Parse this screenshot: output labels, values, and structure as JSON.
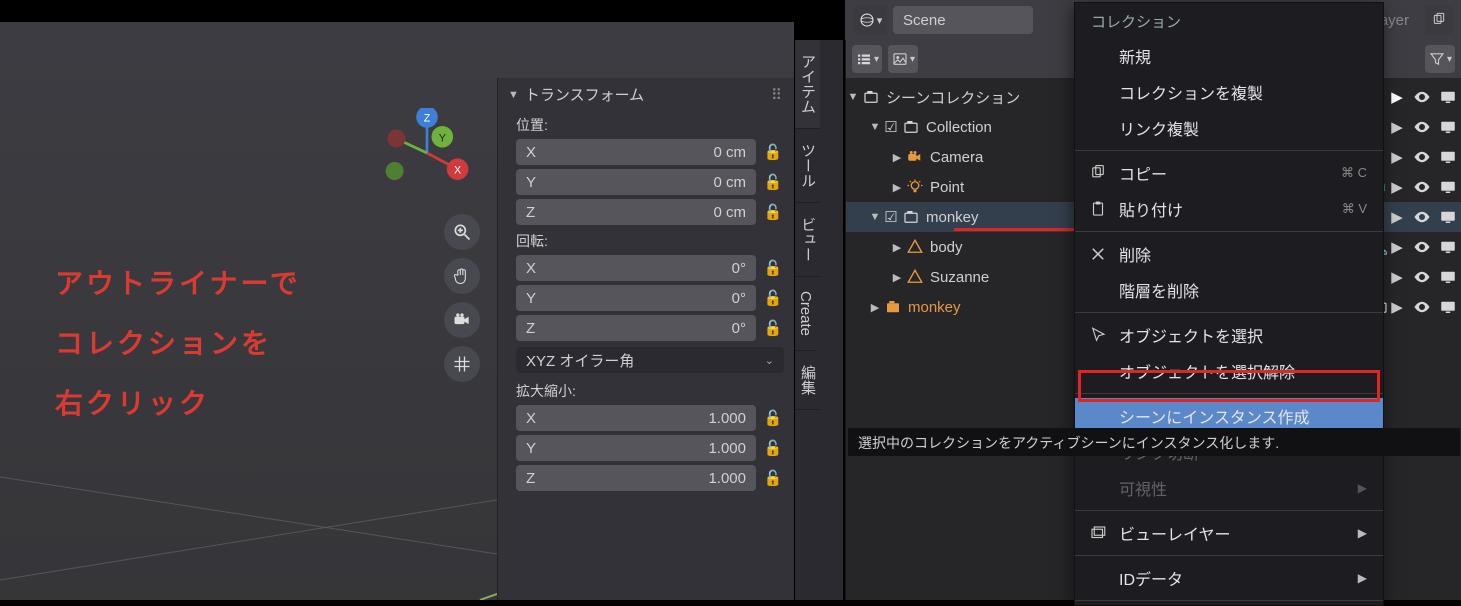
{
  "scene_field": "Scene",
  "view_layer_field": "View Layer",
  "annotation_lines": [
    "アウトライナーで",
    "コレクションを",
    "右クリック"
  ],
  "header": {
    "shading_selected_index": 2
  },
  "npanel": {
    "title": "トランスフォーム",
    "location": {
      "header": "位置:",
      "x_label": "X",
      "y_label": "Y",
      "z_label": "Z",
      "x": "0 cm",
      "y": "0 cm",
      "z": "0 cm"
    },
    "rotation": {
      "header": "回転:",
      "x_label": "X",
      "y_label": "Y",
      "z_label": "Z",
      "x": "0°",
      "y": "0°",
      "z": "0°",
      "mode": "XYZ オイラー角"
    },
    "scale": {
      "header": "拡大縮小:",
      "x_label": "X",
      "y_label": "Y",
      "z_label": "Z",
      "x": "1.000",
      "y": "1.000",
      "z": "1.000"
    }
  },
  "tabs": [
    "アイテム",
    "ツール",
    "ビュー",
    "Create",
    "編集"
  ],
  "outliner": {
    "root": "シーンコレクション",
    "items": [
      {
        "label": "Collection",
        "kind": "collection",
        "children": [
          {
            "label": "Camera",
            "kind": "camera"
          },
          {
            "label": "Point",
            "kind": "light"
          }
        ]
      },
      {
        "label": "monkey",
        "kind": "collection",
        "checked": true,
        "children": [
          {
            "label": "body",
            "kind": "mesh",
            "wrench": true
          },
          {
            "label": "Suzanne",
            "kind": "mesh"
          }
        ]
      },
      {
        "label": "monkey",
        "kind": "instance"
      }
    ]
  },
  "menu": {
    "title": "コレクション",
    "items": [
      {
        "label": "新規"
      },
      {
        "label": "コレクションを複製"
      },
      {
        "label": "リンク複製"
      },
      {
        "sep": true
      },
      {
        "label": "コピー",
        "icon": "copy",
        "kbd": "⌘ C"
      },
      {
        "label": "貼り付け",
        "icon": "paste",
        "kbd": "⌘ V"
      },
      {
        "sep": true
      },
      {
        "label": "削除",
        "icon": "x"
      },
      {
        "label": "階層を削除"
      },
      {
        "sep": true
      },
      {
        "label": "オブジェクトを選択",
        "icon": "cursor"
      },
      {
        "label": "オブジェクトを選択解除"
      },
      {
        "sep": true
      },
      {
        "label": "シーンにインスタンス作成",
        "highlight": true
      },
      {
        "label": "リンク切断",
        "faded": true
      },
      {
        "label": "可視性",
        "faded": true,
        "sub": true
      },
      {
        "sep": true
      },
      {
        "label": "ビューレイヤー",
        "icon": "renderlayers",
        "sub": true
      },
      {
        "sep": true
      },
      {
        "label": "IDデータ",
        "sub": true
      },
      {
        "sep": true
      }
    ]
  },
  "status": "選択中のコレクションをアクティブシーンにインスタンス化します."
}
